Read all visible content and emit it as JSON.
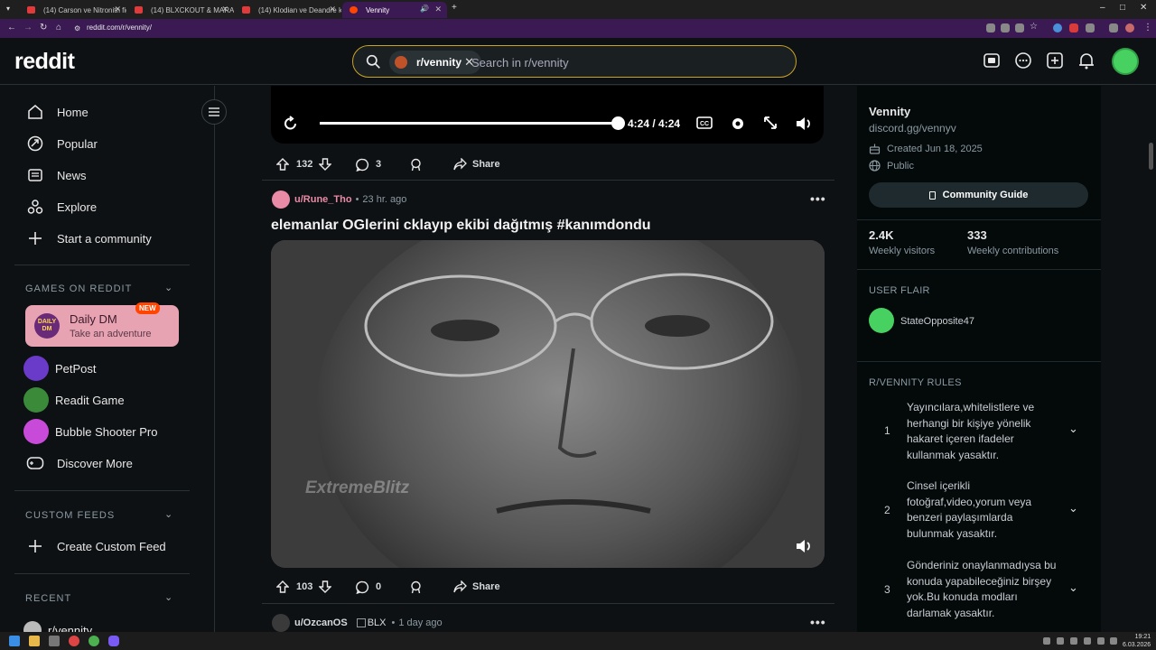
{
  "browser": {
    "tabs": [
      {
        "label": "(14) Carson ve Nitronith fight s"
      },
      {
        "label": "(14) BLXCKOUT & MARA SANT"
      },
      {
        "label": "(14) Klodian ve Deandre konuş"
      },
      {
        "label": "Vennity",
        "active": true
      }
    ],
    "url": "reddit.com/r/vennity/"
  },
  "header": {
    "logo": "reddit",
    "search_chip": "r/vennity",
    "search_placeholder": "Search in r/vennity"
  },
  "leftnav": {
    "items": [
      {
        "label": "Home",
        "icon": "home-icon"
      },
      {
        "label": "Popular",
        "icon": "popular-icon"
      },
      {
        "label": "News",
        "icon": "news-icon"
      },
      {
        "label": "Explore",
        "icon": "explore-icon"
      },
      {
        "label": "Start a community",
        "icon": "plus-icon"
      }
    ],
    "games_heading": "GAMES ON REDDIT",
    "daily_dm": {
      "title": "Daily DM",
      "subtitle": "Take an adventure",
      "badge": "NEW",
      "logo_text": "DAILY DM"
    },
    "games": [
      {
        "label": "PetPost"
      },
      {
        "label": "Readit Game"
      },
      {
        "label": "Bubble Shooter Pro"
      },
      {
        "label": "Discover More"
      }
    ],
    "custom_heading": "CUSTOM FEEDS",
    "create_feed": "Create Custom Feed",
    "recent_heading": "RECENT",
    "recent_item": "r/vennity"
  },
  "player": {
    "time": "4:24 / 4:24",
    "progress": 1.0
  },
  "posts": [
    {
      "upvotes": "132",
      "comments": "3",
      "share": "Share"
    },
    {
      "user": "u/Rune_Tho",
      "time": "23 hr. ago",
      "title": "elemanlar OGlerini cklayıp ekibi dağıtmış #kanımdondu",
      "watermark": "ExtremeBlitz",
      "upvotes": "103",
      "comments": "0",
      "share": "Share"
    },
    {
      "user": "u/OzcanOS",
      "flair": "BLX",
      "time": "1 day ago"
    }
  ],
  "sidebar": {
    "name": "Vennity",
    "link": "discord.gg/vennyv",
    "created": "Created Jun 18, 2025",
    "visibility": "Public",
    "guide_button": "Community Guide",
    "visitors": "2.4K",
    "visitors_label": "Weekly visitors",
    "contributions": "333",
    "contributions_label": "Weekly contributions",
    "flair_heading": "USER FLAIR",
    "flair_user": "StateOpposite47",
    "rules_heading": "R/VENNITY RULES",
    "rules": [
      {
        "num": "1",
        "lines": [
          "Yayıncılara,whitelistlere ve",
          "herhangi bir kişiye yönelik",
          "hakaret içeren ifadeler",
          "kullanmak yasaktır."
        ]
      },
      {
        "num": "2",
        "lines": [
          "Cinsel içerikli",
          "fotoğraf,video,yorum veya",
          "benzeri paylaşımlarda",
          "bulunmak yasaktır."
        ]
      },
      {
        "num": "3",
        "lines": [
          "Gönderiniz onaylanmadıysa bu",
          "konuda yapabileceğiniz birşey",
          "yok.Bu konuda modları",
          "darlamak yasaktır."
        ]
      }
    ]
  },
  "taskbar": {
    "time": "19:21",
    "date": "6.03.2026"
  },
  "colors": {
    "accent": "#ff4500",
    "brand_bg": "#0e1113",
    "active_tab": "#3b1a54",
    "search_border": "#c9a227"
  }
}
